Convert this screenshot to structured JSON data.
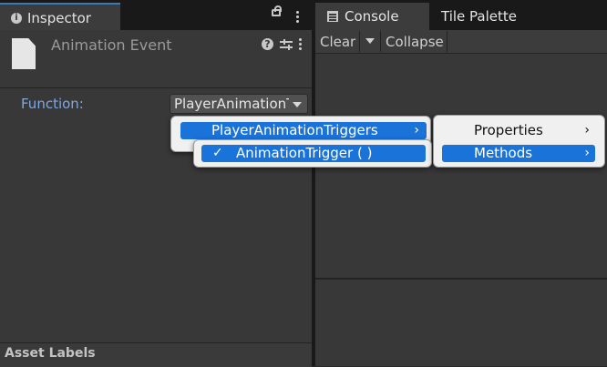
{
  "inspector": {
    "tab_title": "Inspector",
    "info_glyph": "i",
    "component_title": "Animation Event",
    "help_glyph": "?",
    "function_label": "Function:",
    "function_value": "PlayerAnimationTriggers",
    "asset_labels": "Asset Labels"
  },
  "console": {
    "tab_title": "Console",
    "tile_palette_tab": "Tile Palette",
    "clear_label": "Clear",
    "collapse_label": "Collapse"
  },
  "menu_level1": {
    "item_label": "PlayerAnimationTriggers",
    "chevron": "›"
  },
  "menu_level2": {
    "item_label": "AnimationTrigger ( )",
    "checkmark": "✓"
  },
  "menu_level3": {
    "items": [
      {
        "label": "Properties",
        "chevron": "›"
      },
      {
        "label": "Methods",
        "chevron": "›"
      }
    ]
  },
  "colors": {
    "accent": "#1a73d9",
    "panel_bg": "#383838",
    "tab_bar_bg": "#191919",
    "field_label": "#7fa8e0"
  }
}
